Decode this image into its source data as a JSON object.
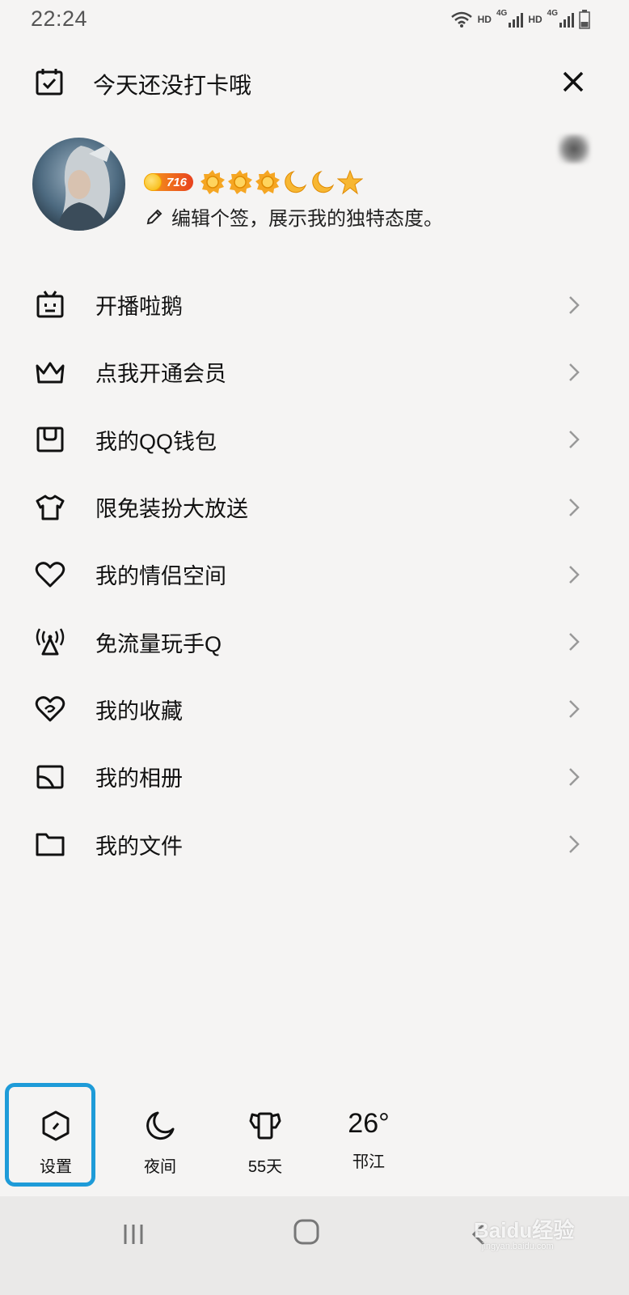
{
  "status_bar": {
    "time": "22:24",
    "sim1_hd": "HD",
    "sim1_net": "4G",
    "sim2_hd": "HD",
    "sim2_net": "4G",
    "battery_level": 0.35
  },
  "header": {
    "title": "今天还没打卡哦",
    "checkin_icon": "calendar-check-icon",
    "close_icon": "close-icon"
  },
  "profile": {
    "coin_value": "716",
    "level_icons": [
      "sun-icon",
      "sun-icon",
      "sun-icon",
      "moon-icon",
      "moon-icon",
      "star-icon"
    ],
    "signature": "编辑个签，展示我的独特态度。"
  },
  "menu": {
    "items": [
      {
        "label": "开播啦鹅",
        "icon": "tv-icon"
      },
      {
        "label": "点我开通会员",
        "icon": "crown-icon"
      },
      {
        "label": "我的QQ钱包",
        "icon": "wallet-icon"
      },
      {
        "label": "限免装扮大放送",
        "icon": "shirt-icon"
      },
      {
        "label": "我的情侣空间",
        "icon": "heart-icon"
      },
      {
        "label": "免流量玩手Q",
        "icon": "signal-tower-icon"
      },
      {
        "label": "我的收藏",
        "icon": "favorite-icon"
      },
      {
        "label": "我的相册",
        "icon": "album-icon"
      },
      {
        "label": "我的文件",
        "icon": "folder-icon"
      }
    ]
  },
  "bottom_bar": {
    "settings_label": "设置",
    "night_label": "夜间",
    "days_label": "55天",
    "weather_temp": "26°",
    "weather_city": "邗江"
  },
  "watermark": {
    "text": "Baidu经验",
    "sub": "jingyan.baidu.com"
  },
  "colors": {
    "background": "#f5f4f3",
    "highlight": "#1e9bd8",
    "coin_badge": "#e8421e",
    "level_icon": "#f5a623"
  }
}
